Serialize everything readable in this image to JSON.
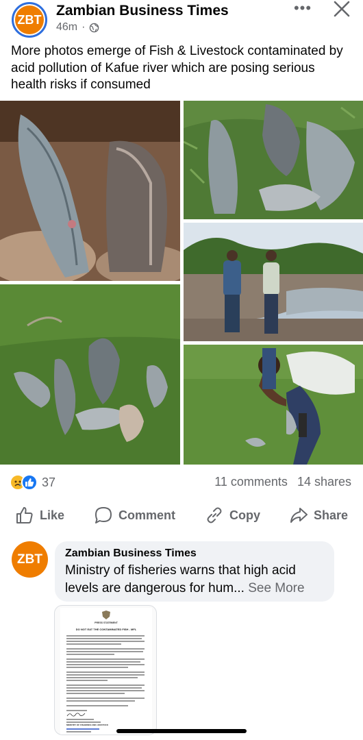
{
  "post": {
    "avatar_text": "ZBT",
    "page_name": "Zambian Business Times",
    "time": "46m",
    "separator": "·",
    "caption": "More photos emerge of Fish & Livestock contaminated by acid pollution of Kafue river which are posing serious health risks if consumed",
    "more_icon": "•••"
  },
  "engagement": {
    "reaction_count": "37",
    "comments": "11 comments",
    "shares": "14 shares"
  },
  "actions": {
    "like": "Like",
    "comment": "Comment",
    "copy": "Copy",
    "share": "Share"
  },
  "comment": {
    "avatar_text": "ZBT",
    "author": "Zambian Business Times",
    "text": "Ministry of fisheries warns that high acid levels are dangerous for hum...",
    "see_more": "See More"
  },
  "attachment": {
    "title": "DO NOT EAT THE CONTAMINATED FISH - MFL",
    "heading": "PRESS STATEMENT",
    "ministry": "MINISTRY OF FISHERIES AND LIVESTOCK"
  },
  "colors": {
    "brand_orange": "#ef7d00",
    "ring_blue": "#2d6fe0",
    "muted_text": "#65676b",
    "bubble_bg": "#f0f2f5"
  }
}
